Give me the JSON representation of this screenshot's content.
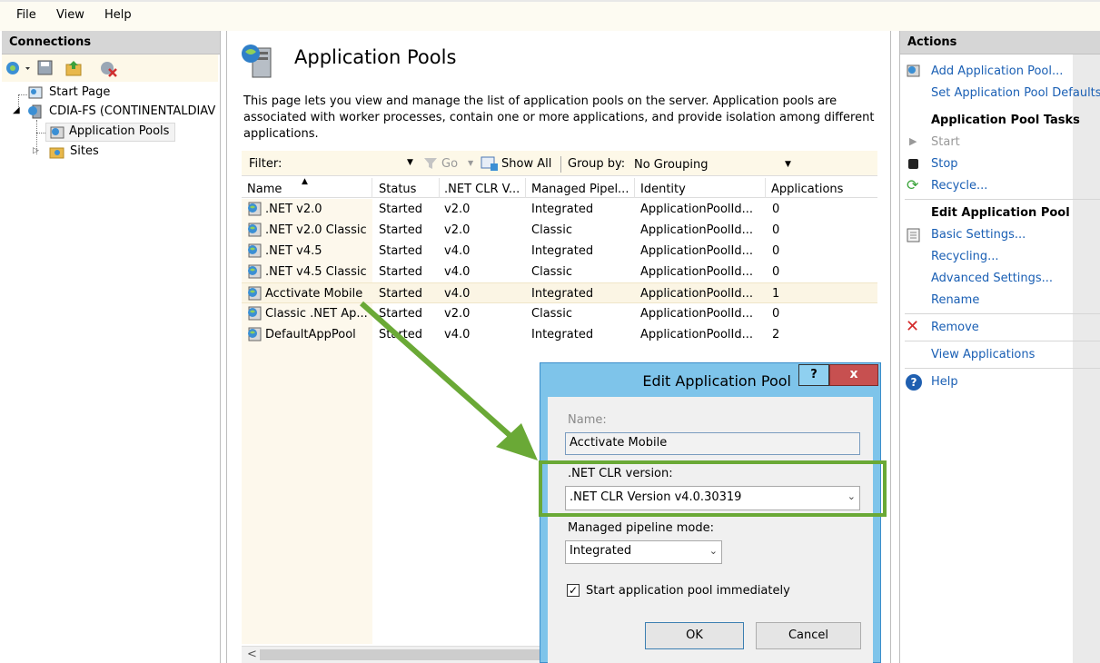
{
  "menu": {
    "file": "File",
    "view": "View",
    "help": "Help"
  },
  "connections": {
    "title": "Connections",
    "tree": {
      "start_page": "Start Page",
      "server": "CDIA-FS (CONTINENTALDIAV",
      "app_pools": "Application Pools",
      "sites": "Sites"
    }
  },
  "main": {
    "title": "Application Pools",
    "description_lines": [
      "This page lets you view and manage the list of application pools on the server. Application pools are",
      "associated with worker processes, contain one or more applications, and provide isolation among different",
      "applications."
    ],
    "filter": {
      "label": "Filter:",
      "go": "Go",
      "show_all": "Show All",
      "group_by_label": "Group by:",
      "group_by_value": "No Grouping"
    },
    "columns": [
      "Name",
      "Status",
      ".NET CLR V...",
      "Managed Pipel...",
      "Identity",
      "Applications"
    ],
    "rows": [
      {
        "name": ".NET v2.0",
        "status": "Started",
        "clr": "v2.0",
        "pipeline": "Integrated",
        "identity": "ApplicationPoolId...",
        "apps": "0"
      },
      {
        "name": ".NET v2.0 Classic",
        "status": "Started",
        "clr": "v2.0",
        "pipeline": "Classic",
        "identity": "ApplicationPoolId...",
        "apps": "0"
      },
      {
        "name": ".NET v4.5",
        "status": "Started",
        "clr": "v4.0",
        "pipeline": "Integrated",
        "identity": "ApplicationPoolId...",
        "apps": "0"
      },
      {
        "name": ".NET v4.5 Classic",
        "status": "Started",
        "clr": "v4.0",
        "pipeline": "Classic",
        "identity": "ApplicationPoolId...",
        "apps": "0"
      },
      {
        "name": "Acctivate Mobile",
        "status": "Started",
        "clr": "v4.0",
        "pipeline": "Integrated",
        "identity": "ApplicationPoolId...",
        "apps": "1"
      },
      {
        "name": "Classic .NET Ap...",
        "status": "Started",
        "clr": "v2.0",
        "pipeline": "Classic",
        "identity": "ApplicationPoolId...",
        "apps": "0"
      },
      {
        "name": "DefaultAppPool",
        "status": "Started",
        "clr": "v4.0",
        "pipeline": "Integrated",
        "identity": "ApplicationPoolId...",
        "apps": "2"
      }
    ]
  },
  "actions": {
    "title": "Actions",
    "add_pool": "Add Application Pool...",
    "set_defaults": "Set Application Pool Defaults...",
    "tasks_heading": "Application Pool Tasks",
    "start": "Start",
    "stop": "Stop",
    "recycle": "Recycle...",
    "edit_heading": "Edit Application Pool",
    "basic_settings": "Basic Settings...",
    "recycling": "Recycling...",
    "advanced_settings": "Advanced Settings...",
    "rename": "Rename",
    "remove": "Remove",
    "view_applications": "View Applications",
    "help": "Help"
  },
  "dialog": {
    "title": "Edit Application Pool",
    "help_btn": "?",
    "close_btn": "x",
    "name_label": "Name:",
    "name_value": "Acctivate Mobile",
    "clr_label": ".NET CLR version:",
    "clr_value": ".NET CLR Version v4.0.30319",
    "pipeline_label": "Managed pipeline mode:",
    "pipeline_value": "Integrated",
    "start_checkbox_label": "Start application pool immediately",
    "start_checked": true,
    "ok": "OK",
    "cancel": "Cancel"
  },
  "colors": {
    "highlight_green": "#6aa936",
    "link_blue": "#1a5fb4",
    "dialog_frame": "#7ec4ea",
    "close_red": "#c75050"
  }
}
